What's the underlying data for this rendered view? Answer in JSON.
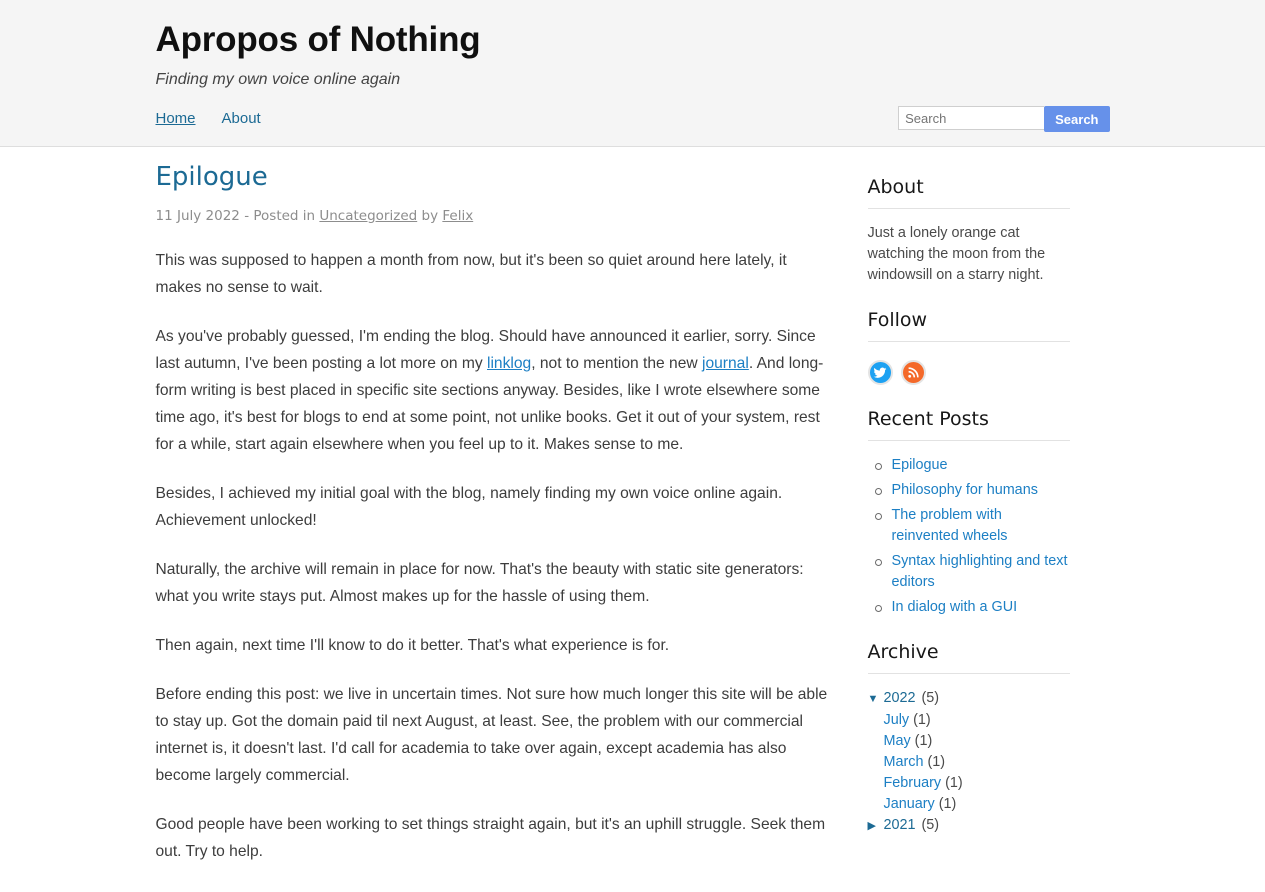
{
  "site": {
    "title": "Apropos of Nothing",
    "tagline": "Finding my own voice online again"
  },
  "nav": {
    "items": [
      {
        "label": "Home",
        "active": true
      },
      {
        "label": "About",
        "active": false
      }
    ]
  },
  "search": {
    "placeholder": "Search",
    "value": "",
    "button_label": "Search"
  },
  "post": {
    "title": "Epilogue",
    "meta": {
      "date": "11 July 2022",
      "separator": " - Posted in ",
      "category": "Uncategorized",
      "by_label": " by ",
      "author": "Felix"
    },
    "paragraphs": [
      {
        "parts": [
          {
            "type": "text",
            "text": "This was supposed to happen a month from now, but it's been so quiet around here lately, it makes no sense to wait."
          }
        ]
      },
      {
        "parts": [
          {
            "type": "text",
            "text": "As you've probably guessed, I'm ending the blog. Should have announced it earlier, sorry. Since last autumn, I've been posting a lot more on my "
          },
          {
            "type": "link",
            "text": "linklog"
          },
          {
            "type": "text",
            "text": ", not to mention the new "
          },
          {
            "type": "link",
            "text": "journal"
          },
          {
            "type": "text",
            "text": ". And long-form writing is best placed in specific site sections anyway. Besides, like I wrote elsewhere some time ago, it's best for blogs to end at some point, not unlike books. Get it out of your system, rest for a while, start again elsewhere when you feel up to it. Makes sense to me."
          }
        ]
      },
      {
        "parts": [
          {
            "type": "text",
            "text": "Besides, I achieved my initial goal with the blog, namely finding my own voice online again. Achievement unlocked!"
          }
        ]
      },
      {
        "parts": [
          {
            "type": "text",
            "text": "Naturally, the archive will remain in place for now. That's the beauty with static site generators: what you write stays put. Almost makes up for the hassle of using them."
          }
        ]
      },
      {
        "parts": [
          {
            "type": "text",
            "text": "Then again, next time I'll know to do it better. That's what experience is for."
          }
        ]
      },
      {
        "parts": [
          {
            "type": "text",
            "text": "Before ending this post: we live in uncertain times. Not sure how much longer this site will be able to stay up. Got the domain paid til next August, at least. See, the problem with our commercial internet is, it doesn't last. I'd call for academia to take over again, except academia has also become largely commercial."
          }
        ]
      },
      {
        "parts": [
          {
            "type": "text",
            "text": "Good people have been working to set things straight again, but it's an uphill struggle. Seek them out. Try to help."
          }
        ]
      }
    ]
  },
  "sidebar": {
    "about": {
      "title": "About",
      "text": "Just a lonely orange cat watching the moon from the windowsill on a starry night."
    },
    "follow": {
      "title": "Follow",
      "icons": [
        {
          "name": "twitter-icon",
          "color": "#1da1f2"
        },
        {
          "name": "rss-icon",
          "color": "#f4692a"
        }
      ]
    },
    "recent_posts": {
      "title": "Recent Posts",
      "items": [
        "Epilogue",
        "Philosophy for humans",
        "The problem with reinvented wheels",
        "Syntax highlighting and text editors",
        "In dialog with a GUI"
      ]
    },
    "archive": {
      "title": "Archive",
      "years": [
        {
          "year": "2022",
          "count": "(5)",
          "expanded": true,
          "marker": "▼",
          "months": [
            {
              "label": "July",
              "count": "(1)"
            },
            {
              "label": "May",
              "count": "(1)"
            },
            {
              "label": "March",
              "count": "(1)"
            },
            {
              "label": "February",
              "count": "(1)"
            },
            {
              "label": "January",
              "count": "(1)"
            }
          ]
        },
        {
          "year": "2021",
          "count": "(5)",
          "expanded": false,
          "marker": "▶",
          "months": []
        }
      ]
    }
  },
  "colors": {
    "link": "#1c7fc4",
    "heading_link": "#1c6a94",
    "button": "#6691ea",
    "header_bg": "#f5f5f5",
    "twitter": "#1da1f2",
    "rss": "#f4692a"
  }
}
